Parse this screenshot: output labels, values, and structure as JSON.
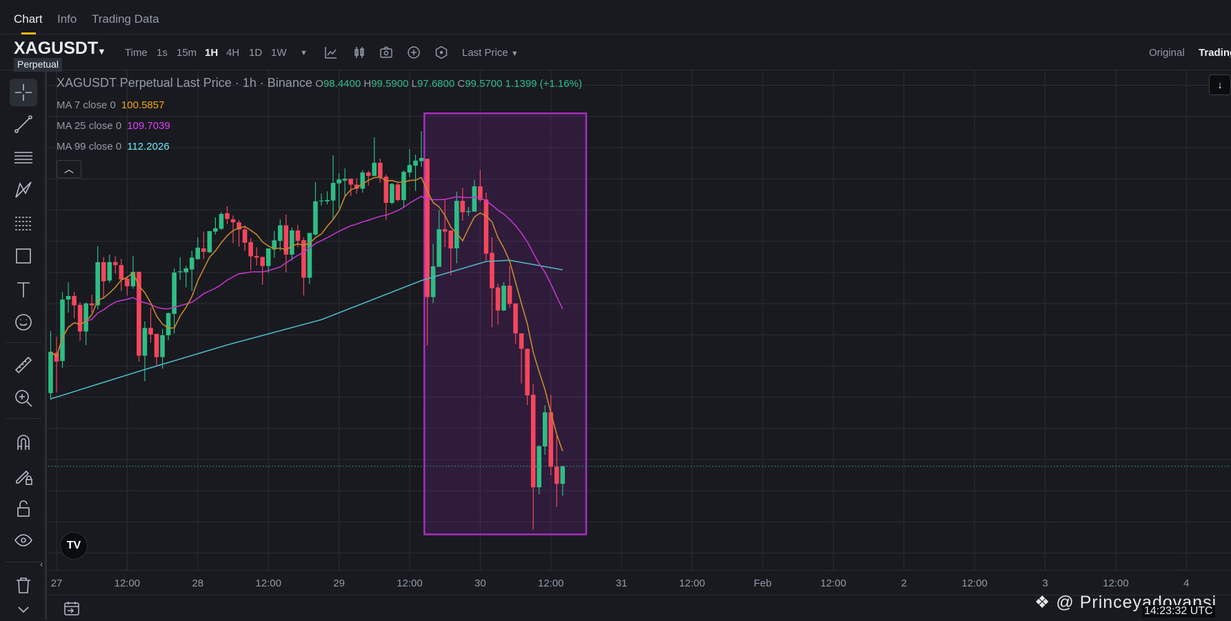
{
  "tabs": [
    "Chart",
    "Info",
    "Trading Data"
  ],
  "symbol": {
    "name": "XAGUSDT",
    "type": "Perpetual"
  },
  "toolbar": {
    "intervals": [
      "Time",
      "1s",
      "15m",
      "1H",
      "4H",
      "1D",
      "1W"
    ],
    "active_interval": "1H",
    "price_type": "Last Price",
    "icons": [
      "indicators-icon",
      "candle-type-icon",
      "camera-icon",
      "add-icon",
      "settings-icon"
    ],
    "view_modes": [
      "Original",
      "Trading"
    ]
  },
  "legend": {
    "title": "XAGUSDT Perpetual Last Price · 1h · Binance",
    "open_label": "O",
    "open": "98.4400",
    "high_label": "H",
    "high": "99.5900",
    "low_label": "L",
    "low": "97.6800",
    "close_label": "C",
    "close": "99.5700",
    "change": "1.1399 (+1.16%)",
    "ma": [
      {
        "label": "MA 7 close 0",
        "value": "100.5857",
        "color": "#f7a600"
      },
      {
        "label": "MA 25 close 0",
        "value": "109.7039",
        "color": "#e040fb"
      },
      {
        "label": "MA 99 close 0",
        "value": "112.2026",
        "color": "#6ee7f2"
      }
    ],
    "collapse_icon": "^"
  },
  "left_tools": [
    "crosshair-icon",
    "trendline-icon",
    "horizontal-lines-icon",
    "pattern-icon",
    "fib-icon",
    "rectangle-icon",
    "text-icon",
    "emoji-icon",
    "ruler-icon",
    "zoom-in-icon",
    "magnet-icon",
    "lock-drawing-icon",
    "unlock-icon",
    "eye-icon",
    "trash-icon",
    "collapse-icon"
  ],
  "logo_text": "TV",
  "watermark": "@ Princeyadovansi",
  "clock": "14:23:32 UTC",
  "colors": {
    "up": "#2ebd85",
    "down": "#f6465d",
    "ma7": "#c98a2e",
    "ma25": "#c236c9",
    "ma99": "#4fb8c4",
    "highlight": "#a72ec0"
  },
  "chart_data": {
    "type": "candlestick",
    "title": "XAGUSDT Perpetual Last Price · 1h · Binance",
    "interval": "1h",
    "first_candle_time": "26 Jan 23:00",
    "candle_format": [
      "open",
      "high",
      "low",
      "close"
    ],
    "candles": [
      [
        104.26,
        108.24,
        103.82,
        106.91
      ],
      [
        106.84,
        107.87,
        104.29,
        106.28
      ],
      [
        106.32,
        110.74,
        105.88,
        110.26
      ],
      [
        110.26,
        111.36,
        109.42,
        110.49
      ],
      [
        110.49,
        110.74,
        109.05,
        109.89
      ],
      [
        109.92,
        110.08,
        107.62,
        108.21
      ],
      [
        108.21,
        110.08,
        107.32,
        110.01
      ],
      [
        110.01,
        110.57,
        109.42,
        109.89
      ],
      [
        109.89,
        113.69,
        109.64,
        112.66
      ],
      [
        112.66,
        112.98,
        110.3,
        111.43
      ],
      [
        111.48,
        113.14,
        111.33,
        112.66
      ],
      [
        112.66,
        113.03,
        111.92,
        112.47
      ],
      [
        112.47,
        112.88,
        110.82,
        111.55
      ],
      [
        111.6,
        111.77,
        110.52,
        111.11
      ],
      [
        111.11,
        113.06,
        110.96,
        112.04
      ],
      [
        112.04,
        112.04,
        106.28,
        106.66
      ],
      [
        106.66,
        108.86,
        105.02,
        108.44
      ],
      [
        108.44,
        109.74,
        107.5,
        108.02
      ],
      [
        108.06,
        108.06,
        105.98,
        106.57
      ],
      [
        106.57,
        108.38,
        105.83,
        107.97
      ],
      [
        107.97,
        109.42,
        107.65,
        109.39
      ],
      [
        109.34,
        112.26,
        108.09,
        111.99
      ],
      [
        112.01,
        112.98,
        111.51,
        112.07
      ],
      [
        112.01,
        112.42,
        111.04,
        112.26
      ],
      [
        112.19,
        113.39,
        110.82,
        112.95
      ],
      [
        112.85,
        114.25,
        112.81,
        113.59
      ],
      [
        113.54,
        114.62,
        112.85,
        113.32
      ],
      [
        113.29,
        114.65,
        113.25,
        114.65
      ],
      [
        114.62,
        115.53,
        114.43,
        114.83
      ],
      [
        114.8,
        115.87,
        114.72,
        115.75
      ],
      [
        115.8,
        116.24,
        115.09,
        115.43
      ],
      [
        115.41,
        115.65,
        113.87,
        115.21
      ],
      [
        115.21,
        115.36,
        113.66,
        114.75
      ],
      [
        114.75,
        115.02,
        113.37,
        113.91
      ],
      [
        113.94,
        114.21,
        112.14,
        113.03
      ],
      [
        113.06,
        113.62,
        112.44,
        112.95
      ],
      [
        112.98,
        113.03,
        111.21,
        112.41
      ],
      [
        112.41,
        113.54,
        111.97,
        113.54
      ],
      [
        113.47,
        114.65,
        112.95,
        114.06
      ],
      [
        114.03,
        115.41,
        113.39,
        115.02
      ],
      [
        115.02,
        115.71,
        111.99,
        113.14
      ],
      [
        113.14,
        114.87,
        112.76,
        114.69
      ],
      [
        114.69,
        115.05,
        113.62,
        114.03
      ],
      [
        114.07,
        114.24,
        110.52,
        111.66
      ],
      [
        111.66,
        114.53,
        111.26,
        114.53
      ],
      [
        114.43,
        117.79,
        114.35,
        116.56
      ],
      [
        116.56,
        117.05,
        116.3,
        116.61
      ],
      [
        116.56,
        117.2,
        116.37,
        116.64
      ],
      [
        116.61,
        119.51,
        115.39,
        117.74
      ],
      [
        117.71,
        118.36,
        116.12,
        117.96
      ],
      [
        117.89,
        118.67,
        116.9,
        118.01
      ],
      [
        118.01,
        118.01,
        116.9,
        117.63
      ],
      [
        117.63,
        118.04,
        117.05,
        117.37
      ],
      [
        117.37,
        118.55,
        117.12,
        118.41
      ],
      [
        118.41,
        118.53,
        117.57,
        118.19
      ],
      [
        118.19,
        120.66,
        118.19,
        119.03
      ],
      [
        119.03,
        119.29,
        117.74,
        118.11
      ],
      [
        118.14,
        118.3,
        115.36,
        116.46
      ],
      [
        116.46,
        117.74,
        116.37,
        117.67
      ],
      [
        117.64,
        117.74,
        116.56,
        116.64
      ],
      [
        116.64,
        118.55,
        116.17,
        118.45
      ],
      [
        118.41,
        119.91,
        118.11,
        118.89
      ],
      [
        118.85,
        119.56,
        117.23,
        119.17
      ],
      [
        119.14,
        121.06,
        118.77,
        119.34
      ],
      [
        119.29,
        119.29,
        107.32,
        110.42
      ],
      [
        110.42,
        113.84,
        110.03,
        112.39
      ],
      [
        112.36,
        116.0,
        112.36,
        114.77
      ],
      [
        114.77,
        116.71,
        113.62,
        114.62
      ],
      [
        114.69,
        114.69,
        111.82,
        113.54
      ],
      [
        113.54,
        117.18,
        112.58,
        116.59
      ],
      [
        116.59,
        117.42,
        115.31,
        115.86
      ],
      [
        115.87,
        116.2,
        115.64,
        115.93
      ],
      [
        115.9,
        117.92,
        115.9,
        117.52
      ],
      [
        117.52,
        118.58,
        116.52,
        116.64
      ],
      [
        116.68,
        117.12,
        112.69,
        113.2
      ],
      [
        113.25,
        114.25,
        108.5,
        110.99
      ],
      [
        111.04,
        111.29,
        108.65,
        109.56
      ],
      [
        109.56,
        111.38,
        109.53,
        111.15
      ],
      [
        111.15,
        112.43,
        109.74,
        109.98
      ],
      [
        110.01,
        110.01,
        107.43,
        108.09
      ],
      [
        108.09,
        108.09,
        104.88,
        107.1
      ],
      [
        107.1,
        107.13,
        103.5,
        104.12
      ],
      [
        104.15,
        104.85,
        95.5,
        98.22
      ],
      [
        98.22,
        100.92,
        97.78,
        100.86
      ],
      [
        100.84,
        103.48,
        100.31,
        103.03
      ],
      [
        103.03,
        104.15,
        98.98,
        99.54
      ],
      [
        99.54,
        101.7,
        96.97,
        98.44
      ],
      [
        98.44,
        99.59,
        97.68,
        99.57
      ]
    ],
    "ma99_points": [
      [
        0,
        103.89
      ],
      [
        15,
        105.66
      ],
      [
        30,
        107.35
      ],
      [
        46,
        108.97
      ],
      [
        63,
        111.48
      ],
      [
        74,
        112.7
      ],
      [
        78,
        112.78
      ],
      [
        87,
        112.17
      ]
    ],
    "last_price": 99.57,
    "price_grid_step": 2,
    "ylim": [
      93,
      125
    ],
    "x_tick_labels": [
      "27",
      "12:00",
      "28",
      "12:00",
      "29",
      "12:00",
      "30",
      "12:00",
      "31",
      "12:00",
      "Feb",
      "12:00",
      "2",
      "12:00",
      "3",
      "12:00",
      "4"
    ],
    "x_tick_step_hours": 12,
    "highlight_box": {
      "from_candle": 63.5,
      "to_hours_after_first": 91,
      "price_top": 122.2,
      "price_bottom": 95.2
    }
  }
}
